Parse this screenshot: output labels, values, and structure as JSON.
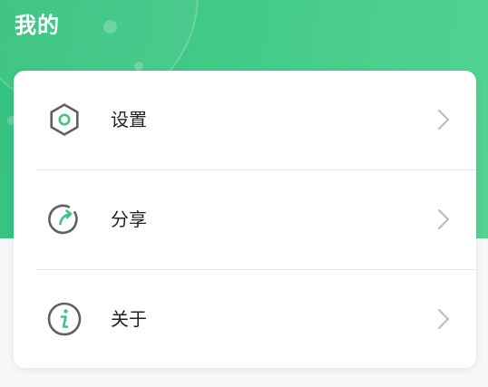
{
  "header": {
    "title": "我的"
  },
  "menu": {
    "items": [
      {
        "label": "设置",
        "icon": "gear-icon"
      },
      {
        "label": "分享",
        "icon": "share-icon"
      },
      {
        "label": "关于",
        "icon": "info-icon"
      }
    ]
  },
  "colors": {
    "brand_green": "#3cc583",
    "icon_gray": "#606060",
    "chevron_gray": "#bdbdbd",
    "text": "#222222"
  }
}
